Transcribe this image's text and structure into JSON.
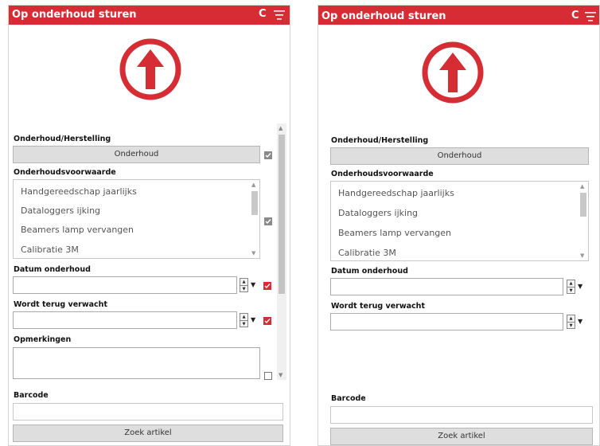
{
  "colors": {
    "accent": "#d62d35",
    "checkbox_gray": "#8a8a8a"
  },
  "panels": [
    {
      "title": "Op onderhoud sturen",
      "c_button": "C",
      "menu_icon": "filter-menu-icon",
      "logo_icon": "arrow-up-circle-icon",
      "type_label": "Onderhoud/Herstelling",
      "type_button": "Onderhoud",
      "condition_label": "Onderhoudsvoorwaarde",
      "conditions": [
        "Handgereedschap jaarlijks",
        "Dataloggers ijking",
        "Beamers lamp vervangen",
        "Calibratie 3M"
      ],
      "date_label": "Datum onderhoud",
      "date_value": "",
      "return_label": "Wordt terug verwacht",
      "return_value": "",
      "remarks_label": "Opmerkingen",
      "remarks_value": "",
      "barcode_label": "Barcode",
      "barcode_value": "",
      "search_button": "Zoek artikel"
    },
    {
      "title": "Op onderhoud sturen",
      "c_button": "C",
      "menu_icon": "filter-menu-icon",
      "logo_icon": "arrow-up-circle-icon",
      "type_label": "Onderhoud/Herstelling",
      "type_button": "Onderhoud",
      "condition_label": "Onderhoudsvoorwaarde",
      "conditions": [
        "Handgereedschap jaarlijks",
        "Dataloggers ijking",
        "Beamers lamp vervangen",
        "Calibratie 3M"
      ],
      "date_label": "Datum onderhoud",
      "date_value": "",
      "return_label": "Wordt terug verwacht",
      "return_value": "",
      "barcode_label": "Barcode",
      "barcode_value": "",
      "search_button": "Zoek artikel"
    }
  ]
}
